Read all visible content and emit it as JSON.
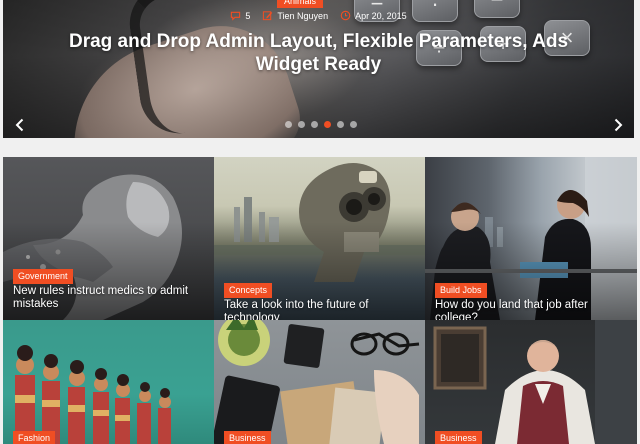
{
  "slider": {
    "category": "Animals",
    "comments": "5",
    "author": "Tien Nguyen",
    "date": "Apr 20, 2015",
    "title": "Drag and Drop Admin Layout, Flexible Parameters, Ads Widget Ready",
    "prev_icon": "chevron-left-icon",
    "next_icon": "chevron-right-icon",
    "dots": 6,
    "active_dot": 3
  },
  "cards": [
    {
      "category": "Government",
      "title": "New rules instruct medics to admit mistakes"
    },
    {
      "category": "Concepts",
      "title": "Take a look into the future of technology"
    },
    {
      "category": "Build Jobs",
      "title": "How do you land that job after college?"
    },
    {
      "category": "Fashion",
      "title": ""
    },
    {
      "category": "Business",
      "title": ""
    },
    {
      "category": "Business",
      "title": ""
    }
  ],
  "colors": {
    "accent": "#f04e23"
  }
}
